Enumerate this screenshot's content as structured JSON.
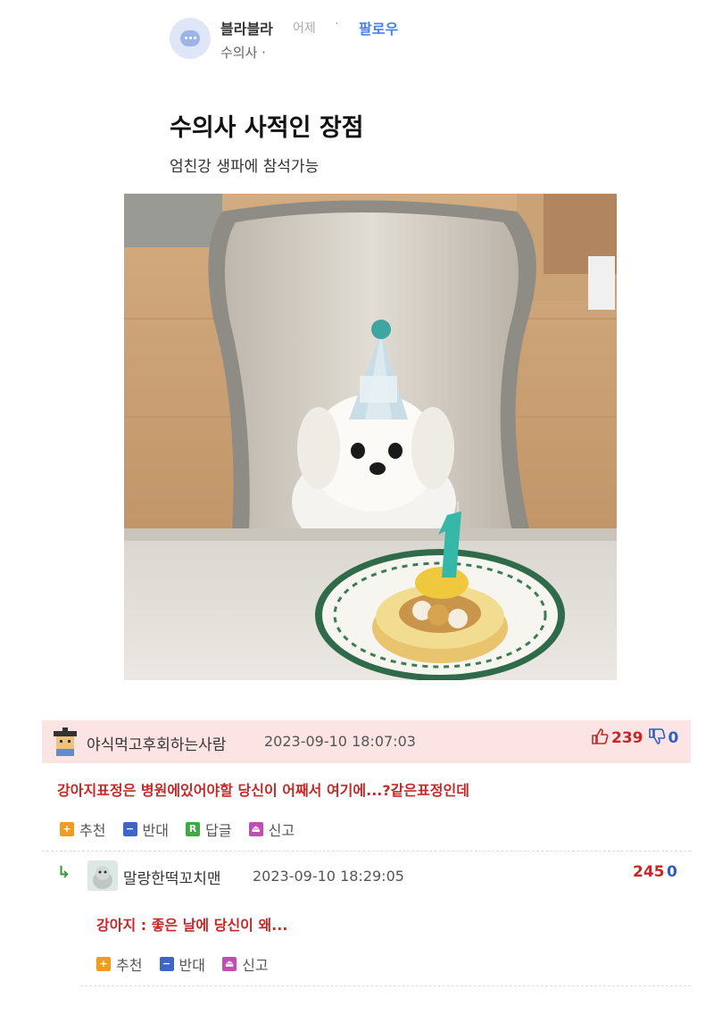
{
  "post": {
    "author": "블라블라",
    "time": "어제",
    "separator": "·",
    "follow_label": "팔로우",
    "category": "수의사 ·",
    "title": "수의사 사적인 장점",
    "subtitle": "엄친강 생파에 참석가능"
  },
  "comments": [
    {
      "username": "야식먹고후회하는사람",
      "date": "2023-09-10 18:07:03",
      "likes": "239",
      "dislikes": "0",
      "text": "강아지표정은 병원에있어야할 당신이 어째서 여기에...?같은표정인데",
      "actions": [
        {
          "label": "추천",
          "glyph": "+"
        },
        {
          "label": "반대",
          "glyph": "−"
        },
        {
          "label": "답글",
          "glyph": "R"
        },
        {
          "label": "신고",
          "glyph": "⏏"
        }
      ]
    },
    {
      "reply_marker": "↳",
      "username": "말랑한떡꼬치맨",
      "date": "2023-09-10 18:29:05",
      "likes": "245",
      "dislikes": "0",
      "text": "강아지 : 좋은 날에 당신이 왜...",
      "actions": [
        {
          "label": "추천",
          "glyph": "+"
        },
        {
          "label": "반대",
          "glyph": "−"
        },
        {
          "label": "신고",
          "glyph": "⏏"
        }
      ]
    }
  ],
  "colors": {
    "follow": "#4a7ff0",
    "comment_highlight": "#fde4e4",
    "comment_text": "#c62828",
    "dislike": "#2e5fc0"
  }
}
